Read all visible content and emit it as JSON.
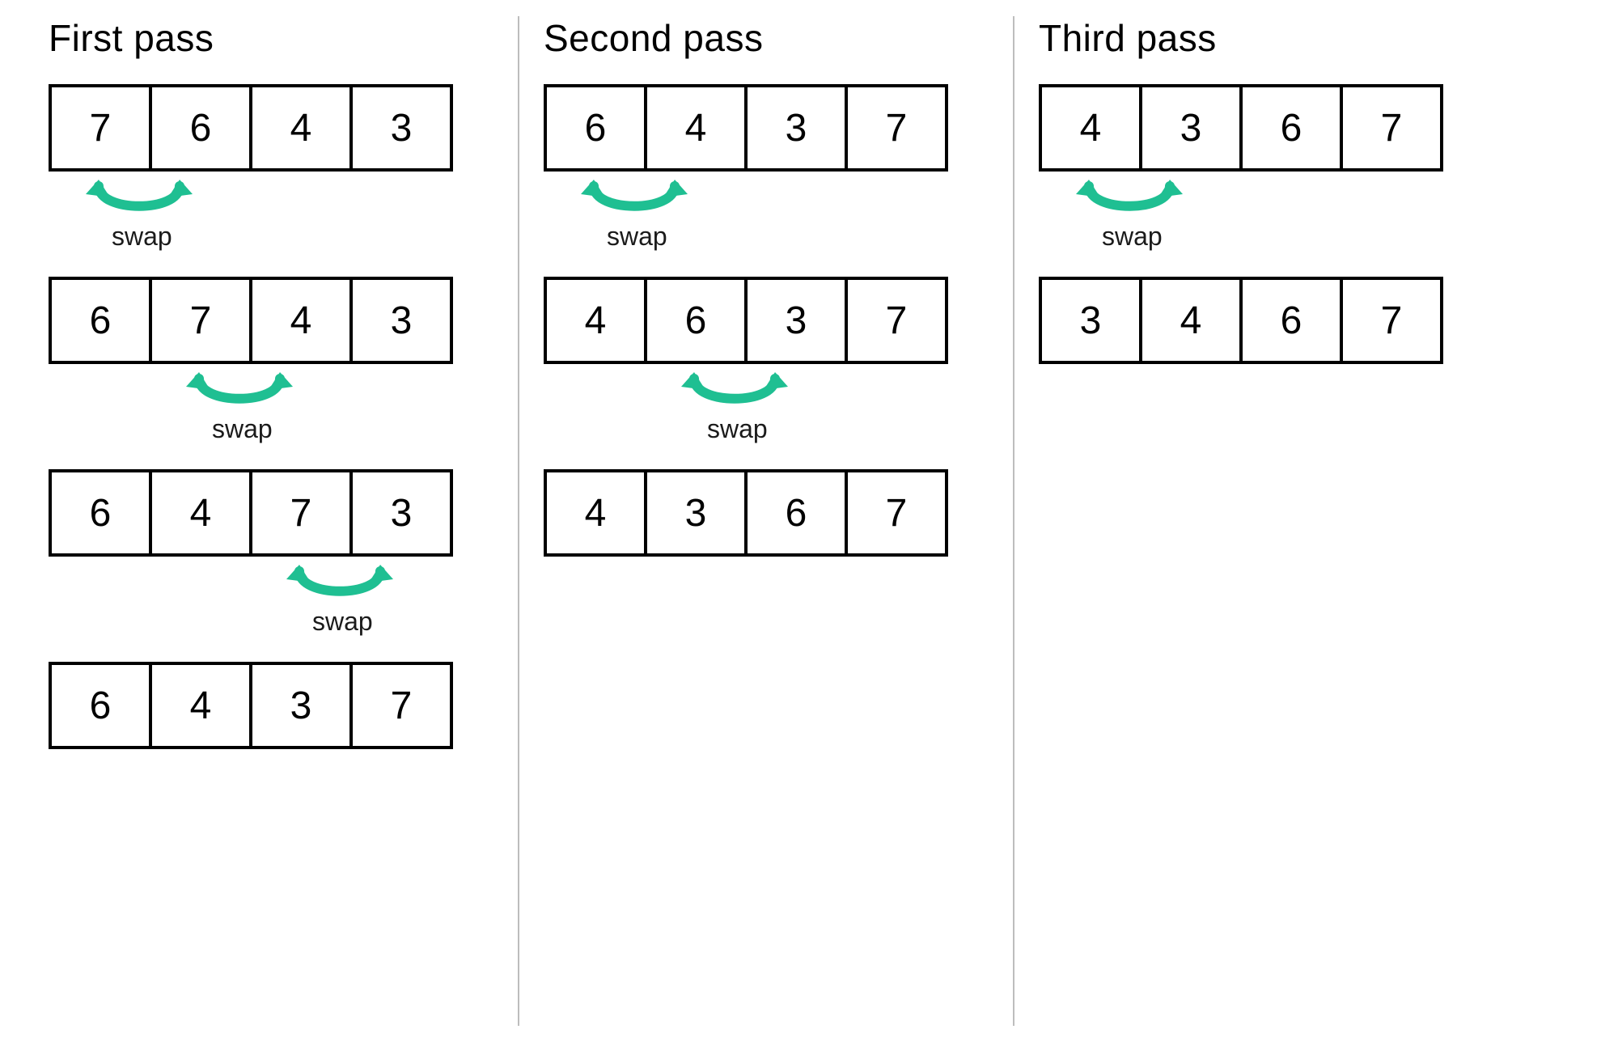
{
  "swap_color": "#1fbf92",
  "swap_text": "swap",
  "passes": [
    {
      "title": "First pass",
      "steps": [
        {
          "values": [
            7,
            6,
            4,
            3
          ],
          "swap_between": 0
        },
        {
          "values": [
            6,
            7,
            4,
            3
          ],
          "swap_between": 1
        },
        {
          "values": [
            6,
            4,
            7,
            3
          ],
          "swap_between": 2
        },
        {
          "values": [
            6,
            4,
            3,
            7
          ],
          "swap_between": null
        }
      ]
    },
    {
      "title": "Second pass",
      "steps": [
        {
          "values": [
            6,
            4,
            3,
            7
          ],
          "swap_between": 0
        },
        {
          "values": [
            4,
            6,
            3,
            7
          ],
          "swap_between": 1
        },
        {
          "values": [
            4,
            3,
            6,
            7
          ],
          "swap_between": null
        }
      ]
    },
    {
      "title": "Third pass",
      "steps": [
        {
          "values": [
            4,
            3,
            6,
            7
          ],
          "swap_between": 0
        },
        {
          "values": [
            3,
            4,
            6,
            7
          ],
          "swap_between": null
        }
      ]
    }
  ]
}
